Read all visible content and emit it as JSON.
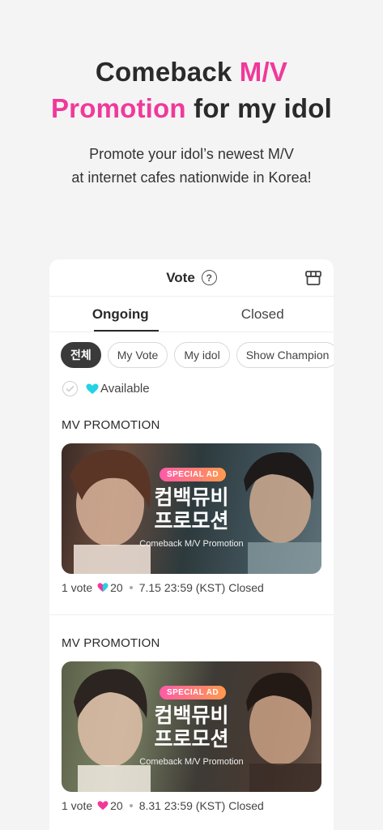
{
  "hero": {
    "line1_a": "Comeback ",
    "line1_b": "M/V",
    "line2_a": "Promotion",
    "line2_b": " for my idol",
    "sub1": "Promote your idol’s newest M/V",
    "sub2": "at internet cafes nationwide in Korea!"
  },
  "header": {
    "title": "Vote",
    "help_icon": "?"
  },
  "tabs": [
    {
      "label": "Ongoing"
    },
    {
      "label": "Closed"
    }
  ],
  "filters": [
    {
      "label": "전체"
    },
    {
      "label": "My Vote"
    },
    {
      "label": "My idol"
    },
    {
      "label": "Show Champion"
    }
  ],
  "available": {
    "label": "Available"
  },
  "items": [
    {
      "section": "MV PROMOTION",
      "badge": "SPECIAL AD",
      "banner_kr_1": "컴백뮤비",
      "banner_kr_2": "프로모션",
      "banner_en": "Comeback M/V Promotion",
      "votes": "1 vote",
      "hearts": "20",
      "deadline": "7.15 23:59 (KST) Closed"
    },
    {
      "section": "MV PROMOTION",
      "badge": "SPECIAL AD",
      "banner_kr_1": "컴백뮤비",
      "banner_kr_2": "프로모션",
      "banner_en": "Comeback M/V Promotion",
      "votes": "1 vote",
      "hearts": "20",
      "deadline": "8.31 23:59 (KST) Closed"
    }
  ],
  "colors": {
    "accent": "#f0399a",
    "heart_available": "#22d3e6",
    "heart_vote": "#f0399a"
  }
}
